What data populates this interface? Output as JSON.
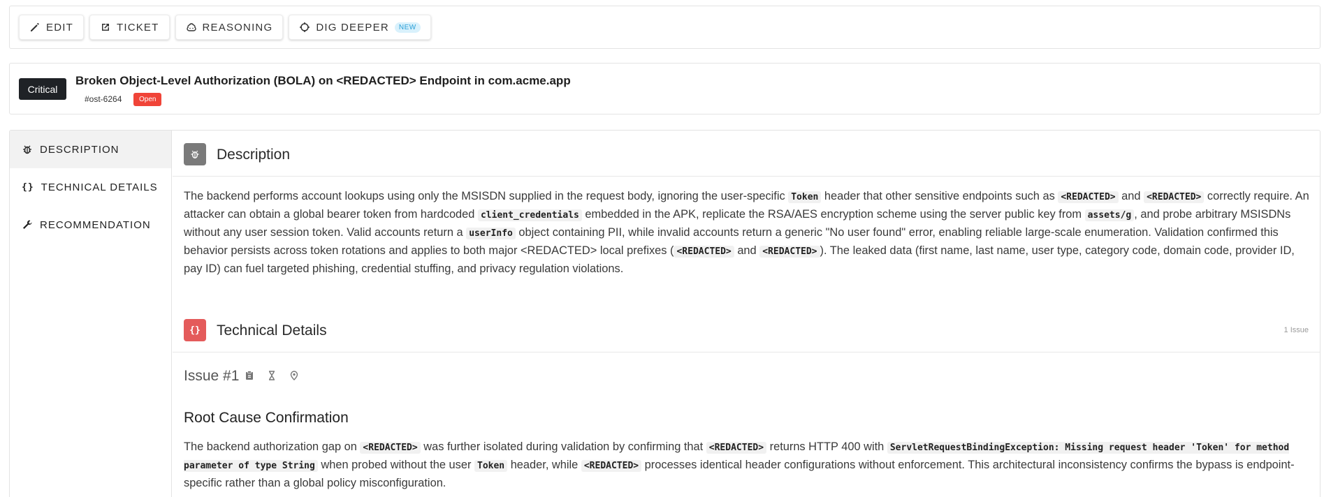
{
  "toolbar": {
    "edit": "EDIT",
    "ticket": "TICKET",
    "reasoning": "REASONING",
    "dig_deeper": "DIG DEEPER",
    "new_badge": "NEW"
  },
  "finding": {
    "severity": "Critical",
    "title": "Broken Object-Level Authorization (BOLA) on <REDACTED> Endpoint in com.acme.app",
    "id": "#ost-6264",
    "status": "Open"
  },
  "sidenav": {
    "items": [
      {
        "label": "DESCRIPTION",
        "icon": "bug-icon",
        "active": true
      },
      {
        "label": "TECHNICAL DETAILS",
        "icon": "code-braces-icon",
        "icon_text": "{}",
        "active": false
      },
      {
        "label": "RECOMMENDATION",
        "icon": "wrench-icon",
        "active": false
      }
    ]
  },
  "description": {
    "title": "Description",
    "p": [
      "The backend performs account lookups using only the MSISDN supplied in the request body, ignoring the user-specific ",
      "Token",
      " header that other sensitive endpoints such as ",
      "<REDACTED>",
      " and ",
      "<REDACTED>",
      " correctly require. An attacker can obtain a global bearer token from hardcoded ",
      "client_credentials",
      " embedded in the APK, replicate the RSA/AES encryption scheme using the server public key from ",
      "assets/g",
      ", and probe arbitrary MSISDNs without any user session token. Valid accounts return a ",
      "userInfo",
      " object containing PII, while invalid accounts return a generic \"No user found\" error, enabling reliable large-scale enumeration. Validation confirmed this behavior persists across token rotations and applies to both major <REDACTED> local prefixes (",
      "<REDACTED>",
      " and ",
      "<REDACTED>",
      "). The leaked data (first name, last name, user type, category code, domain code, provider ID, pay ID) can fuel targeted phishing, credential stuffing, and privacy regulation violations."
    ]
  },
  "technical": {
    "title": "Technical Details",
    "icon_text": "{}",
    "count": "1 Issue",
    "issue_label": "Issue #1",
    "issue_icons": [
      "clipboard-icon",
      "hourglass-icon",
      "location-pin-icon"
    ],
    "subtitle": "Root Cause Confirmation",
    "p": [
      "The backend authorization gap on ",
      "<REDACTED>",
      " was further isolated during validation by confirming that ",
      "<REDACTED>",
      " returns HTTP 400 with ",
      "ServletRequestBindingException: Missing request header 'Token' for method parameter of type String",
      " when probed without the user ",
      "Token",
      " header, while ",
      "<REDACTED>",
      " processes identical header configurations without enforcement. This architectural inconsistency confirms the bypass is endpoint-specific rather than a global policy misconfiguration."
    ]
  }
}
